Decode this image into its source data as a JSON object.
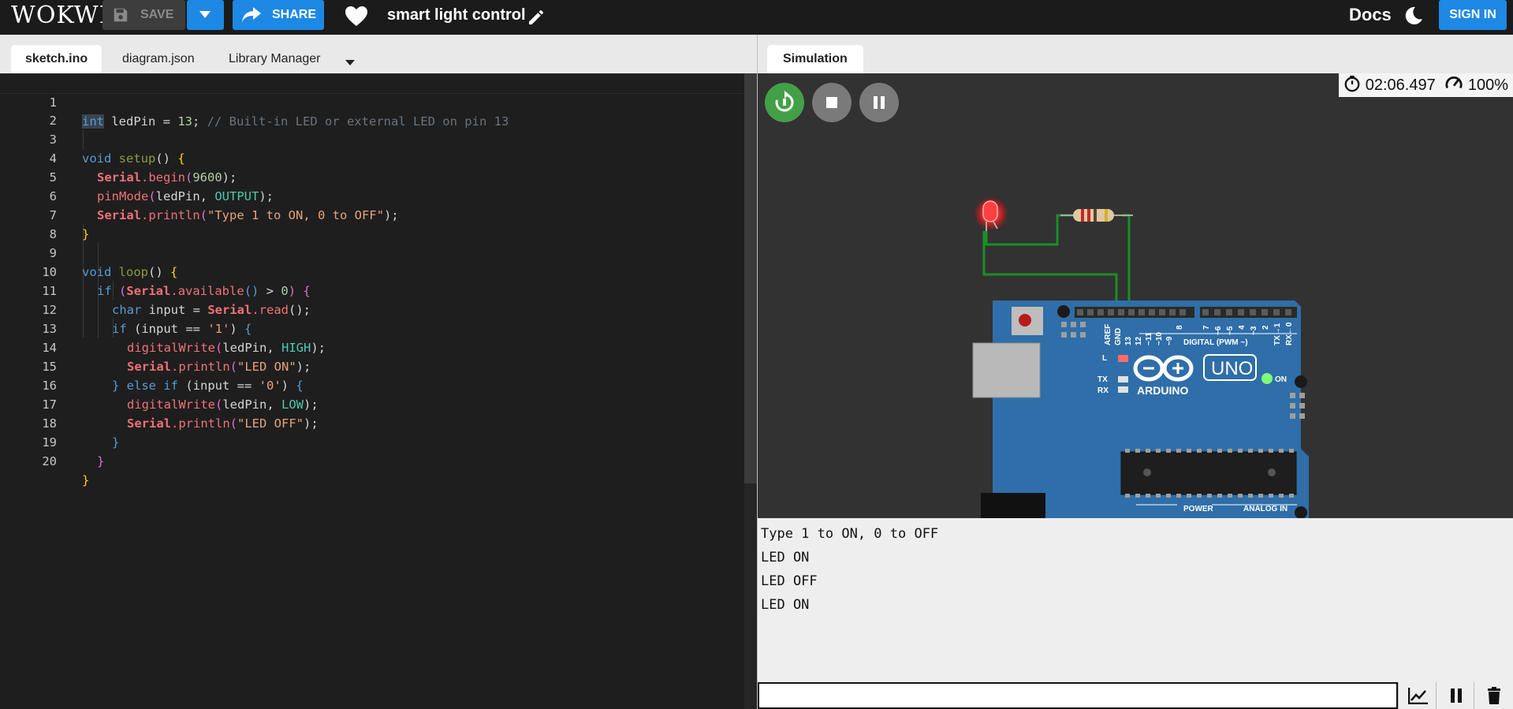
{
  "header": {
    "logo": "WOKWI",
    "save_label": "SAVE",
    "share_label": "SHARE",
    "project_title": "smart light control",
    "docs_label": "Docs",
    "signin_label": "SIGN IN"
  },
  "editor": {
    "tabs": [
      {
        "label": "sketch.ino",
        "active": true
      },
      {
        "label": "diagram.json",
        "active": false
      },
      {
        "label": "Library Manager",
        "active": false
      }
    ],
    "lines": [
      {
        "n": "1"
      },
      {
        "n": "2"
      },
      {
        "n": "3"
      },
      {
        "n": "4"
      },
      {
        "n": "5"
      },
      {
        "n": "6"
      },
      {
        "n": "7"
      },
      {
        "n": "8"
      },
      {
        "n": "9"
      },
      {
        "n": "10"
      },
      {
        "n": "11"
      },
      {
        "n": "12"
      },
      {
        "n": "13"
      },
      {
        "n": "14"
      },
      {
        "n": "15"
      },
      {
        "n": "16"
      },
      {
        "n": "17"
      },
      {
        "n": "18"
      },
      {
        "n": "19"
      },
      {
        "n": "20"
      }
    ],
    "code": {
      "l1": {
        "kw": "int",
        "rest": " ledPin = ",
        "num": "13",
        "semi": "; ",
        "comment": "// Built-in LED or external LED on pin 13"
      },
      "l3": {
        "kw": "void",
        "fn": "setup",
        "paren": "()",
        "brace": " {"
      },
      "l4": {
        "obj": "Serial",
        "method": ".begin",
        "open": "(",
        "num": "9600",
        "close": ");"
      },
      "l5": {
        "fn": "pinMode",
        "open": "(",
        "arg": "ledPin, ",
        "const": "OUTPUT",
        "close": ");"
      },
      "l6": {
        "obj": "Serial",
        "method": ".println",
        "open": "(",
        "str": "\"Type 1 to ON, 0 to OFF\"",
        "close": ");"
      },
      "l7": {
        "brace": "}"
      },
      "l9": {
        "kw": "void",
        "fn": "loop",
        "paren": "()",
        "brace": " {"
      },
      "l10": {
        "kw": "if",
        "sp": " ",
        "open": "(",
        "obj": "Serial",
        "method": ".available",
        "call": "()",
        "op": " > ",
        "num": "0",
        "close": ") ",
        "brace": "{"
      },
      "l11": {
        "kw": "char",
        "rest": " input = ",
        "obj": "Serial",
        "method": ".read",
        "close": "();"
      },
      "l12": {
        "kw": "if",
        "rest": " (input == ",
        "str": "'1'",
        "close": ") ",
        "brace": "{"
      },
      "l13": {
        "fn": "digitalWrite",
        "open": "(",
        "arg": "ledPin, ",
        "const": "HIGH",
        "close": ");"
      },
      "l14": {
        "obj": "Serial",
        "method": ".println",
        "open": "(",
        "str": "\"LED ON\"",
        "close": ");"
      },
      "l15": {
        "brace1": "}",
        "kw": " else if",
        "rest": " (input == ",
        "str": "'0'",
        "close": ") ",
        "brace": "{"
      },
      "l16": {
        "fn": "digitalWrite",
        "open": "(",
        "arg": "ledPin, ",
        "const": "LOW",
        "close": ");"
      },
      "l17": {
        "obj": "Serial",
        "method": ".println",
        "open": "(",
        "str": "\"LED OFF\"",
        "close": ");"
      },
      "l18": {
        "brace": "}"
      },
      "l19": {
        "brace": "}"
      },
      "l20": {
        "brace": "}"
      }
    }
  },
  "simulation": {
    "tab_label": "Simulation",
    "timer": "02:06.497",
    "speed": "100%",
    "board": {
      "name": "UNO",
      "brand": "ARDUINO",
      "digital_label": "DIGITAL (PWM ~)",
      "power_label": "POWER",
      "analog_label": "ANALOG IN",
      "on_label": "ON",
      "tx_label": "TX",
      "rx_label": "RX",
      "l_label": "L",
      "aref_label": "AREF",
      "gnd_label": "GND",
      "pin13_label": "13",
      "pin12_label": "12",
      "pin11_label": "~11",
      "pin10_label": "~10",
      "pin9_label": "~9",
      "pin8_label": "8",
      "pin7_label": "7",
      "pin6_label": "~6",
      "pin5_label": "~5",
      "pin4_label": "4",
      "pin3_label": "~3",
      "pin2_label": "2",
      "tx1_label": "TX→1",
      "rx0_label": "RX←0"
    },
    "led_color": "#ff3030",
    "wire_color": "#1a9e2a"
  },
  "serial_monitor": {
    "lines": [
      "Type 1 to ON, 0 to OFF",
      "LED ON",
      "LED OFF",
      "LED ON"
    ],
    "input_value": ""
  },
  "colors": {
    "accent": "#1e88e5",
    "restart_green": "#43a047",
    "board_blue": "#2f6ea8"
  }
}
